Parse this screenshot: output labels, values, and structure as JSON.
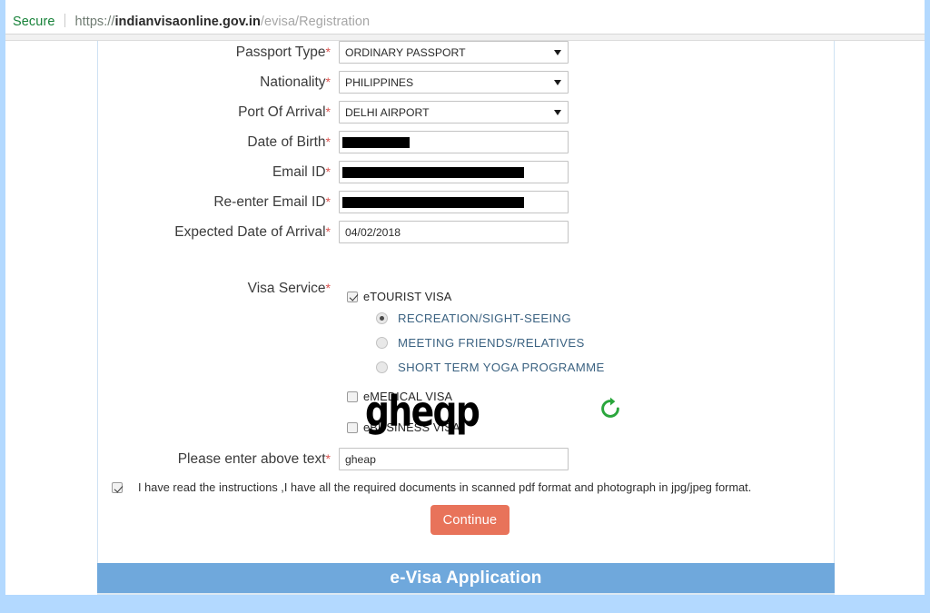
{
  "browser": {
    "security_label": "Secure",
    "url_scheme": "https://",
    "url_host": "indianvisaonline.gov.in",
    "url_path": "/evisa/Registration"
  },
  "form": {
    "fields": [
      {
        "name": "passport-type",
        "label": "Passport Type",
        "required": "*",
        "type": "select",
        "value": "ORDINARY PASSPORT"
      },
      {
        "name": "nationality",
        "label": "Nationality",
        "required": "*",
        "type": "select",
        "value": "PHILIPPINES"
      },
      {
        "name": "port-of-arrival",
        "label": "Port Of Arrival",
        "required": "*",
        "type": "select",
        "value": "DELHI AIRPORT"
      },
      {
        "name": "date-of-birth",
        "label": "Date of Birth",
        "required": "*",
        "type": "text",
        "value": "",
        "redacted": true,
        "redaction_width": 74
      },
      {
        "name": "email-id",
        "label": "Email ID",
        "required": "*",
        "type": "text",
        "value": "",
        "redacted": true,
        "redaction_width": 200
      },
      {
        "name": "reenter-email-id",
        "label": "Re-enter Email ID",
        "required": "*",
        "type": "text",
        "value": "",
        "redacted": true,
        "redaction_width": 200
      },
      {
        "name": "expected-date-of-arrival",
        "label": "Expected Date of Arrival",
        "required": "*",
        "type": "text",
        "value": "04/02/2018",
        "redacted": false
      }
    ],
    "visa_service": {
      "label": "Visa Service",
      "required": "*",
      "checkboxes": [
        {
          "name": "etourist-visa",
          "label": "eTOURIST VISA",
          "checked": true
        },
        {
          "name": "emedical-visa",
          "label": "eMEDICAL VISA",
          "checked": false
        },
        {
          "name": "ebusiness-visa",
          "label": "eBUSINESS VISA",
          "checked": false
        }
      ],
      "tourist_purposes": [
        {
          "name": "recreation-sight-seeing",
          "label": "RECREATION/SIGHT-SEEING",
          "checked": true
        },
        {
          "name": "meeting-friends-relatives",
          "label": "MEETING FRIENDS/RELATIVES",
          "checked": false
        },
        {
          "name": "short-term-yoga-programme",
          "label": "SHORT TERM YOGA PROGRAMME",
          "checked": false
        }
      ]
    },
    "captcha": {
      "image_text": "gheqp",
      "refresh_icon": "refresh-icon",
      "input_label": "Please enter above text",
      "input_required": "*",
      "input_value": "gheap"
    },
    "agreement": {
      "checked": true,
      "text": "I have read the instructions ,I have all the required documents in scanned pdf format and photograph in jpg/jpeg format."
    },
    "submit_label": "Continue"
  },
  "footer": {
    "banner_title": "e-Visa Application"
  },
  "colors": {
    "secure_green": "#178239",
    "required_red": "#d9534f",
    "radio_blue": "#3c6382",
    "button_orange": "#e8735a",
    "banner_blue": "#6fa8dc",
    "frame_blue": "#b3d9ff",
    "refresh_green": "#2aa63c"
  }
}
